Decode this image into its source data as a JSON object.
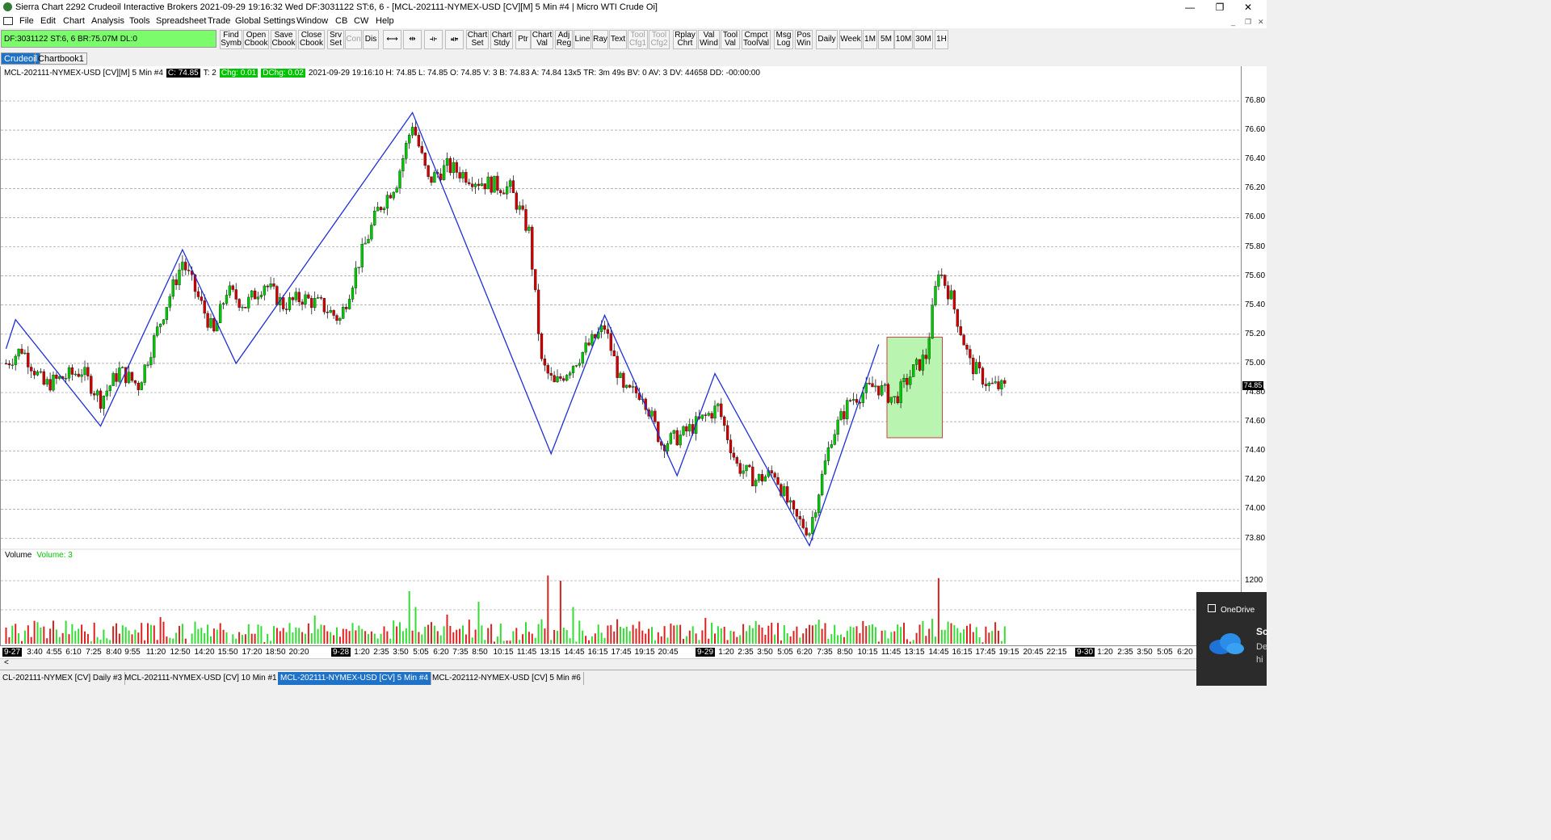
{
  "window": {
    "title": "Sierra Chart 2292 Crudeoil  Interactive Brokers 2021-09-29  19:16:32 Wed  DF:3031122  ST:6, 6 - [MCL-202111-NYMEX-USD [CV][M]  5 Min  #4 | Micro WTI Crude Oi]",
    "minimize": "—",
    "maximize": "❐",
    "close": "✕"
  },
  "menu": [
    "File",
    "Edit",
    "Chart",
    "Analysis",
    "Tools",
    "Spreadsheet",
    "Trade",
    "Global Settings",
    "Window",
    "CB",
    "CW",
    "Help"
  ],
  "status_box": "DF:3031122  ST:6, 6  BR:75.07M  DL:0",
  "toolbar": [
    {
      "l1": "Find",
      "l2": "Symb",
      "dis": false
    },
    {
      "l1": "Open",
      "l2": "Cbook",
      "dis": false
    },
    {
      "l1": "Save",
      "l2": "Cbook",
      "dis": false
    },
    {
      "l1": "Close",
      "l2": "Cbook",
      "dis": false
    },
    {
      "l1": "Srv",
      "l2": "Set",
      "dis": false
    },
    {
      "l1": "Con",
      "l2": "",
      "dis": true
    },
    {
      "l1": "Dis",
      "l2": "",
      "dis": false
    },
    {
      "l1": "⟷",
      "l2": "",
      "dis": false
    },
    {
      "l1": "⇹",
      "l2": "",
      "dis": false
    },
    {
      "l1": "⟛",
      "l2": "",
      "dis": false
    },
    {
      "l1": "⟚",
      "l2": "",
      "dis": false
    },
    {
      "l1": "Chart",
      "l2": "Set",
      "dis": false
    },
    {
      "l1": "Chart",
      "l2": "Stdy",
      "dis": false
    },
    {
      "l1": "Ptr",
      "l2": "",
      "dis": false
    },
    {
      "l1": "Chart",
      "l2": "Val",
      "dis": false
    },
    {
      "l1": "Adj",
      "l2": "Reg",
      "dis": false
    },
    {
      "l1": "Line",
      "l2": "",
      "dis": false
    },
    {
      "l1": "Ray",
      "l2": "",
      "dis": false
    },
    {
      "l1": "Text",
      "l2": "",
      "dis": false
    },
    {
      "l1": "Tool",
      "l2": "Cfg1",
      "dis": true
    },
    {
      "l1": "Tool",
      "l2": "Cfg2",
      "dis": true
    },
    {
      "l1": "Rplay",
      "l2": "Chrt",
      "dis": false
    },
    {
      "l1": "Val",
      "l2": "Wind",
      "dis": false
    },
    {
      "l1": "Tool",
      "l2": "Val",
      "dis": false
    },
    {
      "l1": "Cmpct",
      "l2": "ToolVal",
      "dis": false
    },
    {
      "l1": "Msg",
      "l2": "Log",
      "dis": false
    },
    {
      "l1": "Pos",
      "l2": "Win",
      "dis": false
    },
    {
      "l1": "Daily",
      "l2": "",
      "dis": false
    },
    {
      "l1": "Week",
      "l2": "",
      "dis": false
    },
    {
      "l1": "1M",
      "l2": "",
      "dis": false
    },
    {
      "l1": "5M",
      "l2": "",
      "dis": false
    },
    {
      "l1": "10M",
      "l2": "",
      "dis": false
    },
    {
      "l1": "30M",
      "l2": "",
      "dis": false
    },
    {
      "l1": "1H",
      "l2": "",
      "dis": false
    }
  ],
  "chartbook_tabs": [
    "Crudeoil",
    "Chartbook1"
  ],
  "info": {
    "symbol": "MCL-202111-NYMEX-USD [CV][M]  5 Min   #4",
    "close": "C: 74.85",
    "trades": "T: 2",
    "chg": "Chg: 0.01",
    "dchg": "DChg: 0.02",
    "rest": "2021-09-29 19:16:10 H: 74.85 L: 74.85 O: 74.85 V: 3 B: 74.83 A: 74.84 13x5 TR: 3m 49s BV: 0 AV: 3 DV: 44658 DD: -00:00:00"
  },
  "volume_label": {
    "name": "Volume",
    "value": "Volume: 3"
  },
  "last_price": "74.85",
  "y_ticks": [
    "76.80",
    "76.60",
    "76.40",
    "76.20",
    "76.00",
    "75.80",
    "75.60",
    "75.40",
    "75.20",
    "75.00",
    "74.80",
    "74.60",
    "74.40",
    "74.20",
    "74.00",
    "73.80"
  ],
  "vol_tick": "1200",
  "x_labels": [
    {
      "t": "9-27",
      "day": true
    },
    {
      "t": "3:40"
    },
    {
      "t": "4:55"
    },
    {
      "t": "6:10"
    },
    {
      "t": "7:25"
    },
    {
      "t": "8:40"
    },
    {
      "t": "9:55"
    },
    {
      "t": "11:20"
    },
    {
      "t": "12:50"
    },
    {
      "t": "14:20"
    },
    {
      "t": "15:50"
    },
    {
      "t": "17:20"
    },
    {
      "t": "18:50"
    },
    {
      "t": "20:20"
    },
    {
      "t": "9-28",
      "day": true
    },
    {
      "t": "1:20"
    },
    {
      "t": "2:35"
    },
    {
      "t": "3:50"
    },
    {
      "t": "5:05"
    },
    {
      "t": "6:20"
    },
    {
      "t": "7:35"
    },
    {
      "t": "8:50"
    },
    {
      "t": "10:15"
    },
    {
      "t": "11:45"
    },
    {
      "t": "13:15"
    },
    {
      "t": "14:45"
    },
    {
      "t": "16:15"
    },
    {
      "t": "17:45"
    },
    {
      "t": "19:15"
    },
    {
      "t": "20:45"
    },
    {
      "t": "9-29",
      "day": true
    },
    {
      "t": "1:20"
    },
    {
      "t": "2:35"
    },
    {
      "t": "3:50"
    },
    {
      "t": "5:05"
    },
    {
      "t": "6:20"
    },
    {
      "t": "7:35"
    },
    {
      "t": "8:50"
    },
    {
      "t": "10:15"
    },
    {
      "t": "11:45"
    },
    {
      "t": "13:15"
    },
    {
      "t": "14:45"
    },
    {
      "t": "16:15"
    },
    {
      "t": "17:45"
    },
    {
      "t": "19:15"
    },
    {
      "t": "20:45"
    },
    {
      "t": "22:15"
    },
    {
      "t": "9-30",
      "day": true
    },
    {
      "t": "1:20"
    },
    {
      "t": "2:35"
    },
    {
      "t": "3:50"
    },
    {
      "t": "5:05"
    },
    {
      "t": "6:20"
    }
  ],
  "bottom_tabs": [
    {
      "t": "CL-202111-NYMEX [CV]  Daily  #3",
      "active": false
    },
    {
      "t": "MCL-202111-NYMEX-USD [CV]  10 Min   #1",
      "active": false
    },
    {
      "t": "MCL-202111-NYMEX-USD [CV]  5 Min   #4",
      "active": true
    },
    {
      "t": "MCL-202112-NYMEX-USD [CV]  5 Min   #6",
      "active": false
    }
  ],
  "toast": {
    "app": "OneDrive",
    "title": "Sc",
    "line1": "De",
    "line2": "hi"
  },
  "colors": {
    "up": "#00c800",
    "down": "#d00000",
    "zigzag": "#1f2fd6",
    "highlight": "#b9f5b0",
    "grid": "#888888"
  },
  "chart_data": {
    "type": "candlestick",
    "price_range": [
      73.7,
      76.87
    ],
    "zigzag": [
      [
        0,
        75.1
      ],
      [
        3,
        75.3
      ],
      [
        30,
        74.57
      ],
      [
        56,
        75.78
      ],
      [
        73,
        75.0
      ],
      [
        129,
        76.72
      ],
      [
        173,
        74.38
      ],
      [
        190,
        75.33
      ],
      [
        213,
        74.23
      ],
      [
        225,
        74.93
      ],
      [
        255,
        73.75
      ],
      [
        277,
        75.13
      ]
    ],
    "highlight_box": {
      "from_bar": 280,
      "to_bar": 295,
      "low": 74.49,
      "high": 75.18
    },
    "close_path": [
      [
        0,
        75.0
      ],
      [
        5,
        75.1
      ],
      [
        12,
        74.85
      ],
      [
        18,
        74.9
      ],
      [
        24,
        74.95
      ],
      [
        30,
        74.75
      ],
      [
        36,
        74.95
      ],
      [
        42,
        74.85
      ],
      [
        50,
        75.35
      ],
      [
        56,
        75.7
      ],
      [
        62,
        75.4
      ],
      [
        66,
        75.2
      ],
      [
        70,
        75.5
      ],
      [
        76,
        75.4
      ],
      [
        82,
        75.55
      ],
      [
        88,
        75.4
      ],
      [
        94,
        75.45
      ],
      [
        100,
        75.4
      ],
      [
        106,
        75.3
      ],
      [
        112,
        75.7
      ],
      [
        118,
        76.05
      ],
      [
        124,
        76.25
      ],
      [
        129,
        76.65
      ],
      [
        134,
        76.25
      ],
      [
        140,
        76.35
      ],
      [
        150,
        76.25
      ],
      [
        160,
        76.2
      ],
      [
        166,
        75.9
      ],
      [
        170,
        75.0
      ],
      [
        174,
        74.85
      ],
      [
        180,
        75.0
      ],
      [
        186,
        75.15
      ],
      [
        190,
        75.25
      ],
      [
        196,
        74.8
      ],
      [
        202,
        74.8
      ],
      [
        208,
        74.45
      ],
      [
        214,
        74.5
      ],
      [
        220,
        74.6
      ],
      [
        226,
        74.7
      ],
      [
        232,
        74.3
      ],
      [
        238,
        74.2
      ],
      [
        244,
        74.25
      ],
      [
        250,
        73.95
      ],
      [
        255,
        73.85
      ],
      [
        262,
        74.5
      ],
      [
        268,
        74.75
      ],
      [
        276,
        74.85
      ],
      [
        282,
        74.75
      ],
      [
        288,
        74.95
      ],
      [
        292,
        75.05
      ],
      [
        296,
        75.65
      ],
      [
        300,
        75.45
      ],
      [
        306,
        75.0
      ],
      [
        312,
        74.85
      ],
      [
        317,
        74.83
      ]
    ],
    "volume_max": 1300,
    "volume_spikes": [
      [
        128,
        1000
      ],
      [
        172,
        1300
      ],
      [
        176,
        1200
      ],
      [
        296,
        1250
      ],
      [
        130,
        700
      ],
      [
        150,
        800
      ],
      [
        180,
        700
      ]
    ]
  }
}
